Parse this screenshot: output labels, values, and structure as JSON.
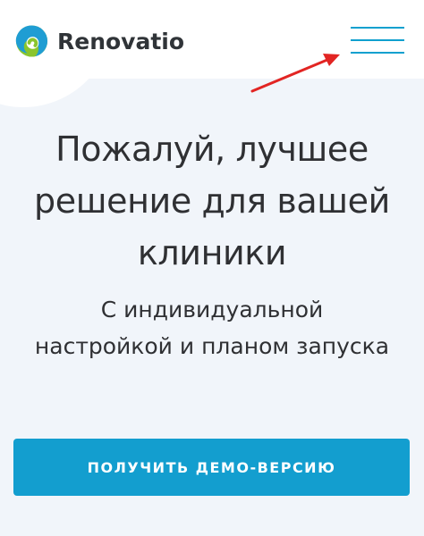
{
  "header": {
    "logo": {
      "icon": "renovatio-logo-icon",
      "name": "Renovatio",
      "colors": {
        "green": "#8ac52d",
        "blue": "#1f9dd3",
        "dark": "#303438"
      }
    },
    "menu": {
      "icon": "hamburger-menu-icon",
      "color": "#0fa0cf"
    },
    "annotation": {
      "icon": "arrow-icon",
      "color": "#e22523"
    }
  },
  "hero": {
    "headline_lines": [
      "Пожалуй, лучшее",
      "решение для вашей",
      "клиники"
    ],
    "subheadline_lines": [
      "С индивидуальной",
      "настройкой и планом запуска"
    ],
    "cta_label": "ПОЛУЧИТЬ ДЕМО-ВЕРСИЮ",
    "cta_color": "#139ecf"
  },
  "theme": {
    "page_background": "#f1f5fa",
    "header_background": "#ffffff",
    "text_color": "#2f3033"
  }
}
